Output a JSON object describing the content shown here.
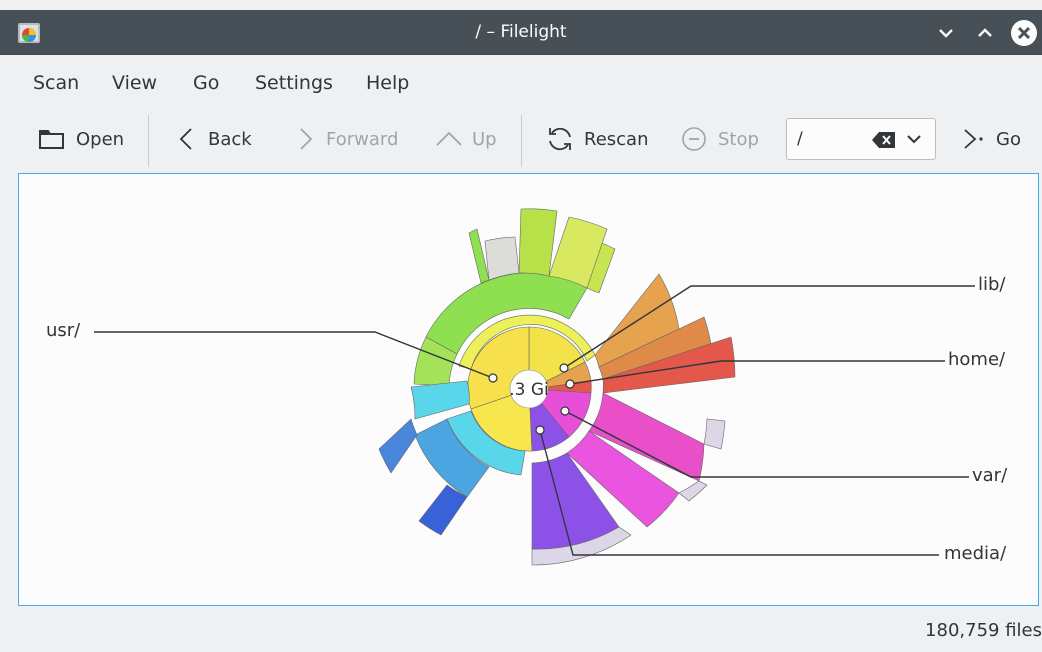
{
  "window": {
    "title": "/ – Filelight"
  },
  "menu": {
    "items": [
      "Scan",
      "View",
      "Go",
      "Settings",
      "Help"
    ]
  },
  "toolbar": {
    "open_label": "Open",
    "back_label": "Back",
    "forward_label": "Forward",
    "up_label": "Up",
    "rescan_label": "Rescan",
    "stop_label": "Stop",
    "path_value": "/",
    "go_label": "Go"
  },
  "map": {
    "center_label": ".3 Gi",
    "labels": {
      "usr": "usr/",
      "lib": "lib/",
      "home": "home/",
      "var": "var/",
      "media": "media/"
    },
    "colors": {
      "usr": "#f3e24a",
      "lib": "#e6a24e",
      "home": "#e3584a",
      "var": "#e84fd8",
      "media": "#8c52e8",
      "other": "#5ad6ea",
      "selection_border": "#3daee9"
    }
  },
  "status": {
    "file_count": "180,759 files"
  }
}
